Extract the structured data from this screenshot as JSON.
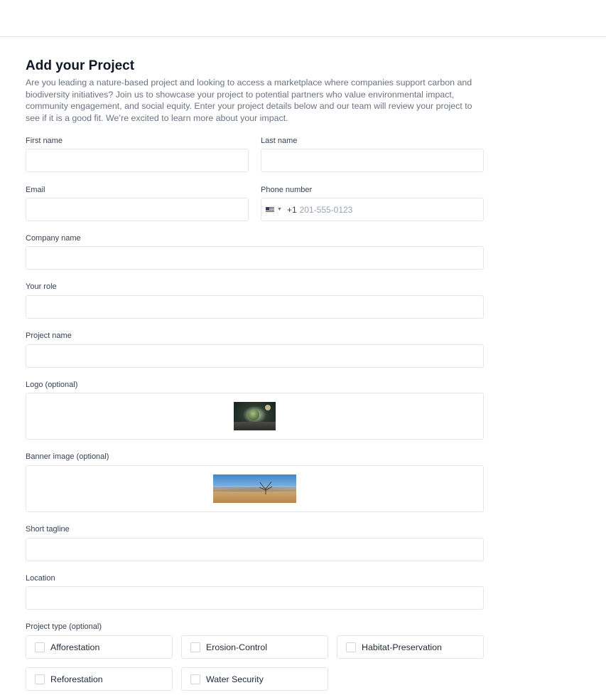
{
  "form": {
    "title": "Add your Project",
    "intro": "Are you leading a nature-based project and looking to access a marketplace where companies support carbon and biodiversity initiatives?  Join us to showcase your project to potential partners who value environmental impact, community engagement, and social equity. Enter your project details below and our team will review your project to see if it is a good fit.  We’re excited to learn more about your impact."
  },
  "fields": {
    "first_name": {
      "label": "First name",
      "value": ""
    },
    "last_name": {
      "label": "Last name",
      "value": ""
    },
    "email": {
      "label": "Email",
      "value": ""
    },
    "phone": {
      "label": "Phone number",
      "country_icon": "us-flag-icon",
      "dial_code": "+1",
      "placeholder": "201-555-0123",
      "value": ""
    },
    "company_name": {
      "label": "Company name",
      "value": ""
    },
    "role": {
      "label": "Your role",
      "value": ""
    },
    "project_name": {
      "label": "Project name",
      "value": ""
    },
    "logo": {
      "label": "Logo (optional)"
    },
    "banner": {
      "label": "Banner image (optional)"
    },
    "tagline": {
      "label": "Short tagline",
      "value": ""
    },
    "location": {
      "label": "Location",
      "value": ""
    }
  },
  "project_type": {
    "label": "Project type (optional)",
    "options": [
      {
        "label": "Afforestation",
        "checked": false
      },
      {
        "label": "Erosion-Control",
        "checked": false
      },
      {
        "label": "Habitat-Preservation",
        "checked": false
      },
      {
        "label": "Reforestation",
        "checked": false
      },
      {
        "label": "Water Security",
        "checked": false
      }
    ]
  }
}
